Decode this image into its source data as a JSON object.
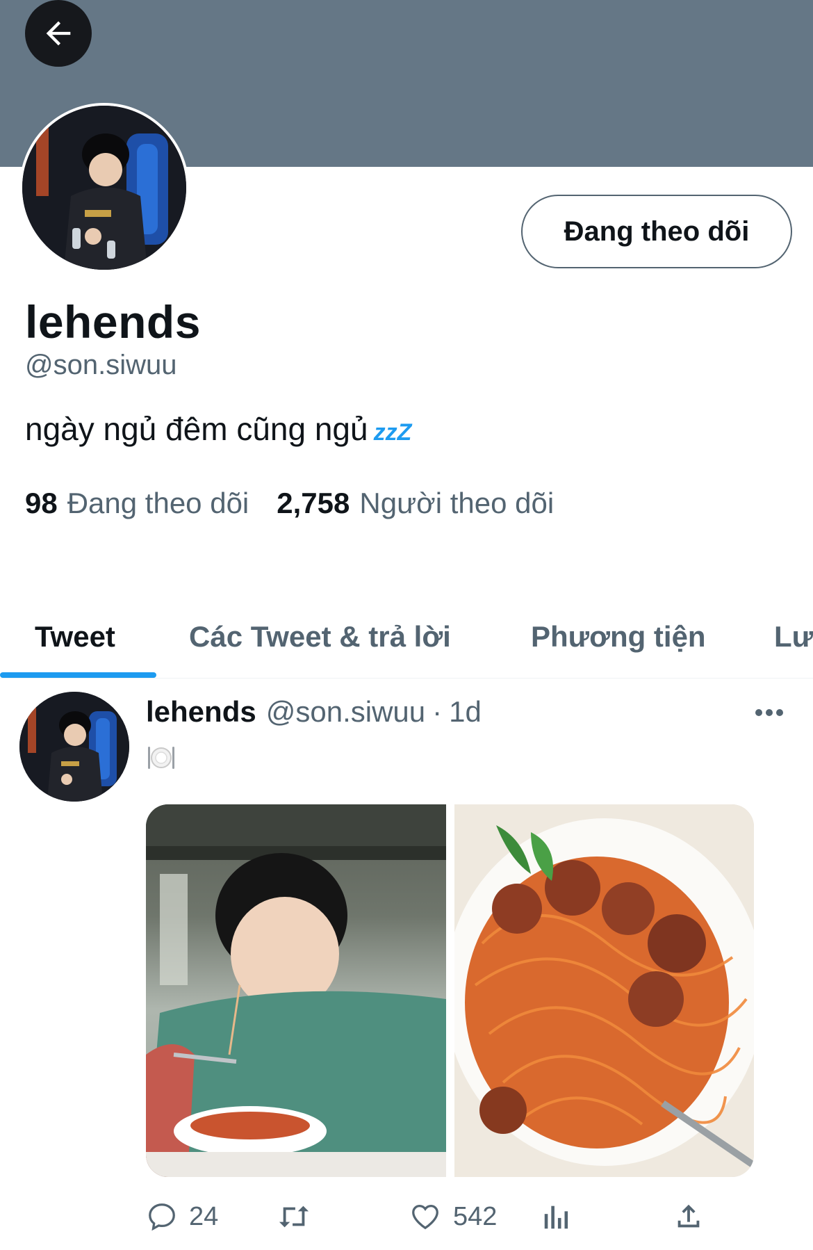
{
  "header": {
    "back_icon": "arrow-left-icon"
  },
  "profile": {
    "display_name": "lehends",
    "handle": "@son.siwuu",
    "bio": "ngày ngủ đêm cũng ngủ",
    "bio_emoji": "zzZ",
    "follow_button_label": "Đang theo dõi"
  },
  "stats": {
    "following_count": "98",
    "following_label": "Đang theo dõi",
    "followers_count": "2,758",
    "followers_label": "Người theo dõi"
  },
  "tabs": [
    {
      "label": "Tweet",
      "active": true
    },
    {
      "label": "Các Tweet & trả lời",
      "active": false
    },
    {
      "label": "Phương tiện",
      "active": false
    },
    {
      "label": "Lư",
      "active": false
    }
  ],
  "tweet": {
    "name": "lehends",
    "handle": "@son.siwuu",
    "separator": "·",
    "time": "1d",
    "text_icon": "plate-cutlery-icon",
    "media": [
      "photo-person-eating-spaghetti",
      "photo-spaghetti-meatballs"
    ],
    "actions": {
      "reply_count": "24",
      "retweet_count": "",
      "like_count": "542"
    }
  },
  "colors": {
    "banner": "#657786",
    "accent": "#1d9bf0",
    "text_primary": "#0f1419",
    "text_secondary": "#536471"
  }
}
